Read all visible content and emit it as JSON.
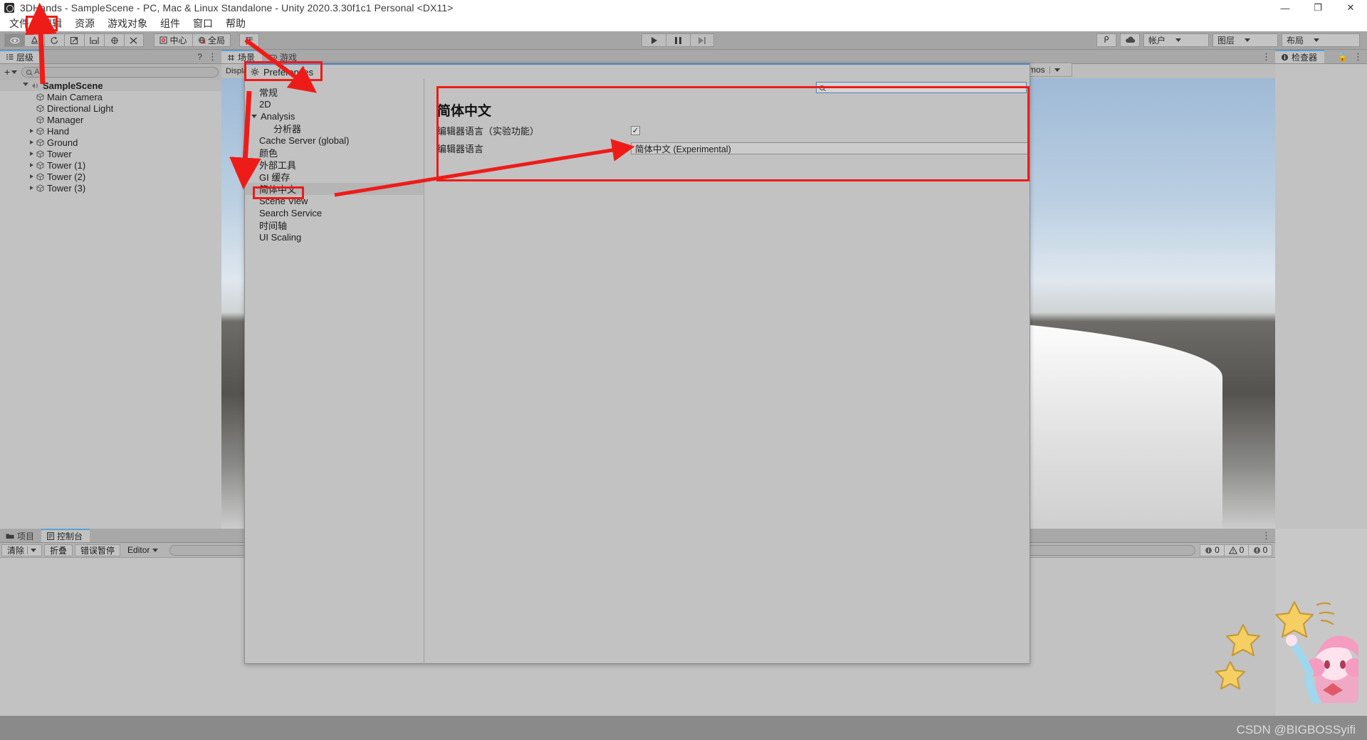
{
  "window": {
    "title": "3DHands - SampleScene - PC, Mac & Linux Standalone - Unity 2020.3.30f1c1 Personal <DX11>",
    "minimize": "—",
    "maximize": "❐",
    "close": "✕"
  },
  "menubar": {
    "items": [
      {
        "label": "文件"
      },
      {
        "label": "编辑"
      },
      {
        "label": "资源"
      },
      {
        "label": "游戏对象"
      },
      {
        "label": "组件"
      },
      {
        "label": "窗口"
      },
      {
        "label": "帮助"
      }
    ]
  },
  "toolbar": {
    "pivot_label": "中心",
    "space_label": "全局",
    "account_label": "帐户",
    "layers_label": "图层",
    "layout_label": "布局",
    "icons": {
      "hand": "hand-tool-icon",
      "move": "move-tool-icon",
      "rotate": "rotate-tool-icon",
      "scale": "scale-tool-icon",
      "rect": "rect-tool-icon",
      "transform": "transform-tool-icon",
      "custom": "custom-tool-icon",
      "snap": "snap-icon",
      "collab": "collab-icon",
      "cloud": "cloud-icon"
    }
  },
  "hierarchy": {
    "tab_label": "层级",
    "search_placeholder": "All",
    "add_label": "+",
    "root": "SampleScene",
    "items": [
      {
        "label": "Main Camera",
        "expandable": false,
        "indent": 1
      },
      {
        "label": "Directional Light",
        "expandable": false,
        "indent": 1
      },
      {
        "label": "Manager",
        "expandable": false,
        "indent": 1
      },
      {
        "label": "Hand",
        "expandable": true,
        "indent": 1
      },
      {
        "label": "Ground",
        "expandable": true,
        "indent": 1
      },
      {
        "label": "Tower",
        "expandable": true,
        "indent": 1
      },
      {
        "label": "Tower (1)",
        "expandable": true,
        "indent": 1
      },
      {
        "label": "Tower (2)",
        "expandable": true,
        "indent": 1
      },
      {
        "label": "Tower (3)",
        "expandable": true,
        "indent": 1
      }
    ]
  },
  "sceneview": {
    "tab_scene": "场景",
    "tab_game": "游戏",
    "display_label": "Display"
  },
  "inspector": {
    "tab_label": "检查器",
    "gizmos_label": "Gizmos"
  },
  "console": {
    "tab_project": "项目",
    "tab_console": "控制台",
    "clear_label": "清除",
    "collapse_label": "折叠",
    "error_pause_label": "错误暂停",
    "editor_label": "Editor",
    "log_count": "0",
    "warn_count": "0",
    "error_count": "0"
  },
  "preferences": {
    "title": "Preferences",
    "search_value": "",
    "sidebar": [
      {
        "label": "常规",
        "indent": 0,
        "twisty": false,
        "selected": false
      },
      {
        "label": "2D",
        "indent": 0,
        "twisty": false,
        "selected": false
      },
      {
        "label": "Analysis",
        "indent": 0,
        "twisty": true,
        "selected": false
      },
      {
        "label": "分析器",
        "indent": 1,
        "twisty": false,
        "selected": false
      },
      {
        "label": "Cache Server (global)",
        "indent": 0,
        "twisty": false,
        "selected": false
      },
      {
        "label": "颜色",
        "indent": 0,
        "twisty": false,
        "selected": false
      },
      {
        "label": "外部工具",
        "indent": 0,
        "twisty": false,
        "selected": false
      },
      {
        "label": "GI 缓存",
        "indent": 0,
        "twisty": false,
        "selected": false
      },
      {
        "label": "简体中文",
        "indent": 0,
        "twisty": false,
        "selected": true
      },
      {
        "label": "Scene View",
        "indent": 0,
        "twisty": false,
        "selected": false
      },
      {
        "label": "Search Service",
        "indent": 0,
        "twisty": false,
        "selected": false
      },
      {
        "label": "时间轴",
        "indent": 0,
        "twisty": false,
        "selected": false
      },
      {
        "label": "UI Scaling",
        "indent": 0,
        "twisty": false,
        "selected": false
      }
    ],
    "page_title": "简体中文",
    "fields": {
      "experimental_label": "编辑器语言（实验功能）",
      "experimental_checked": "✓",
      "language_label": "编辑器语言",
      "language_value": "简体中文 (Experimental)"
    }
  },
  "annotations": {
    "color": "#ee1c18",
    "note": "red highlight boxes and arrows"
  },
  "watermark": {
    "text": "CSDN @BIGBOSSyifi"
  }
}
